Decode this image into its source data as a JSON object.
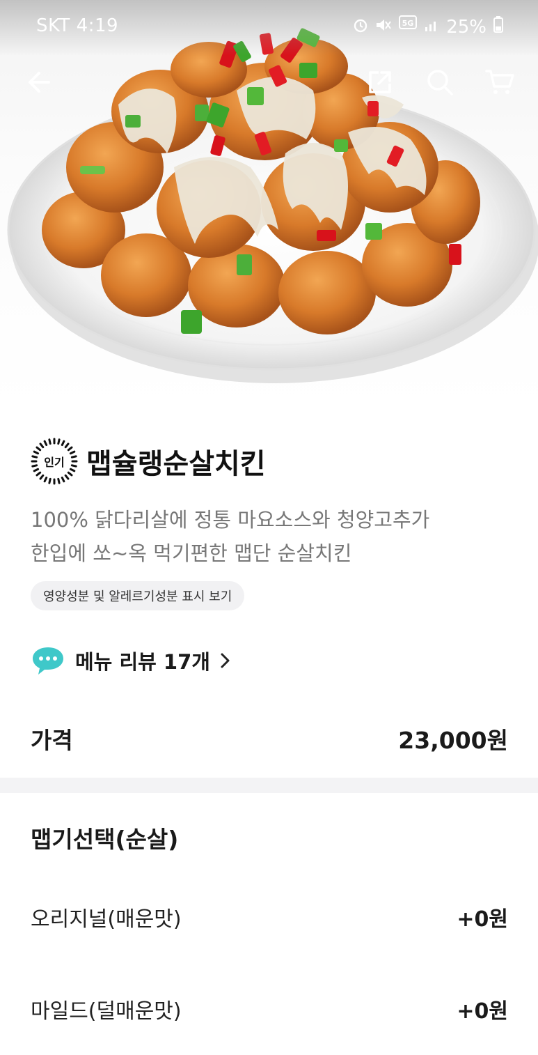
{
  "status_bar": {
    "carrier_time": "SKT 4:19",
    "battery": "25%",
    "network": "5G"
  },
  "nav": {
    "back_icon": "arrow-left-icon",
    "share_icon": "share-icon",
    "search_icon": "search-icon",
    "cart_icon": "cart-icon"
  },
  "product": {
    "badge": "인기",
    "title": "맵슐랭순살치킨",
    "description_lines": [
      "100% 닭다리살에 정통 마요소스와 청양고추가",
      "한입에 쏘~옥 먹기편한 맵단 순살치킨"
    ],
    "nutrition_chip": "영양성분 및 알레르기성분 표시 보기"
  },
  "review": {
    "label": "메뉴 리뷰 17개"
  },
  "price": {
    "label": "가격",
    "value": "23,000원"
  },
  "options": {
    "title": "맵기선택(순살)",
    "items": [
      {
        "name": "오리지널(매운맛)",
        "price": "+0원"
      },
      {
        "name": "마일드(덜매운맛)",
        "price": "+0원"
      }
    ]
  },
  "colors": {
    "review_bubble": "#3fc8c9",
    "divider": "#f3f3f5"
  }
}
